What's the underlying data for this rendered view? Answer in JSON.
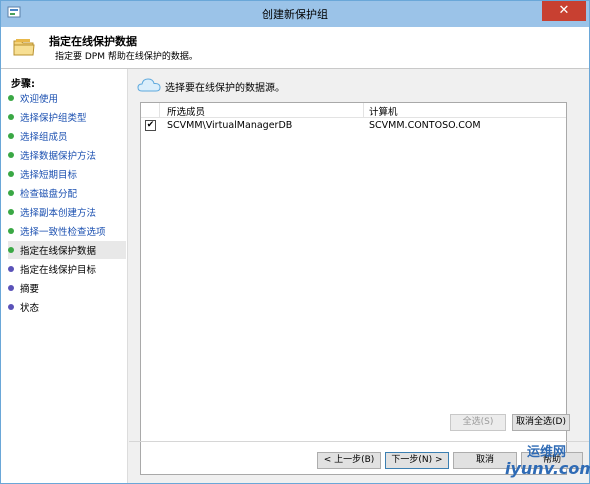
{
  "window": {
    "title": "创建新保护组",
    "close_glyph": "✕"
  },
  "header": {
    "title": "指定在线保护数据",
    "subtitle": "指定要 DPM 帮助在线保护的数据。"
  },
  "steps": {
    "heading": "步骤:",
    "items": [
      {
        "label": "欢迎使用",
        "state": "done"
      },
      {
        "label": "选择保护组类型",
        "state": "done"
      },
      {
        "label": "选择组成员",
        "state": "done"
      },
      {
        "label": "选择数据保护方法",
        "state": "done"
      },
      {
        "label": "选择短期目标",
        "state": "done"
      },
      {
        "label": "检查磁盘分配",
        "state": "done"
      },
      {
        "label": "选择副本创建方法",
        "state": "done"
      },
      {
        "label": "选择一致性检查选项",
        "state": "done"
      },
      {
        "label": "指定在线保护数据",
        "state": "current"
      },
      {
        "label": "指定在线保护目标",
        "state": "pending"
      },
      {
        "label": "摘要",
        "state": "pending"
      },
      {
        "label": "状态",
        "state": "pending"
      }
    ]
  },
  "content": {
    "instruction": "选择要在线保护的数据源。",
    "columns": [
      "所选成员",
      "计算机"
    ],
    "rows": [
      {
        "checked": true,
        "check_glyph": "✔",
        "member": "SCVMM\\VirtualManagerDB",
        "computer": "SCVMM.CONTOSO.COM"
      }
    ],
    "select_all": "全选(S)",
    "deselect_all": "取消全选(D)"
  },
  "footer": {
    "back": "< 上一步(B)",
    "next": "下一步(N) >",
    "cancel": "取消",
    "help": "帮助"
  },
  "watermark": {
    "top": "运维网",
    "bottom": "iyunv.com"
  },
  "colors": {
    "titlebar": "#9bc3e8",
    "close": "#c84031",
    "step_done": "#3aa845",
    "step_pending": "#5a52b8",
    "link": "#1a4fb0"
  },
  "icons": {
    "app": "dpm-app-icon",
    "header": "folder-icon",
    "content": "cloud-icon"
  }
}
